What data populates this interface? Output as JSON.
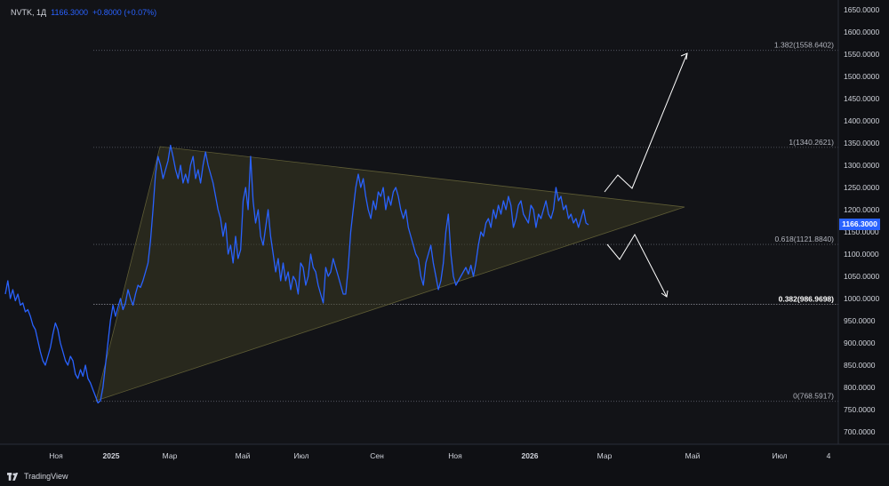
{
  "header": {
    "symbol": "NVTK, 1Д",
    "price": "1166.3000",
    "change": "+0.8000 (+0.07%)"
  },
  "price_tag": "1166.3000",
  "brand": "TradingView",
  "colors": {
    "background": "#0f1014",
    "line": "#2962ff",
    "triangle_fill": "#3a3820",
    "triangle_edge": "#6b6a3a",
    "fib_line": "#787b86",
    "arrow": "#ffffff",
    "axis_text": "#d1d4dc"
  },
  "chart_data": {
    "type": "line",
    "title": "",
    "xlabel": "",
    "ylabel": "",
    "ylim": [
      680,
      1665
    ],
    "y_ticks": [
      "1650.0000",
      "1600.0000",
      "1550.0000",
      "1500.0000",
      "1450.0000",
      "1400.0000",
      "1350.0000",
      "1300.0000",
      "1250.0000",
      "1200.0000",
      "1150.0000",
      "1100.0000",
      "1050.0000",
      "1000.0000",
      "950.0000",
      "900.0000",
      "850.0000",
      "800.0000",
      "750.0000",
      "700.0000"
    ],
    "x_ticks": [
      "Ноя",
      "2025",
      "Мар",
      "Май",
      "Июл",
      "Сен",
      "Ноя",
      "2026",
      "Мар",
      "Май",
      "Июл",
      "4"
    ],
    "x_tick_bold": [
      "2025",
      "2026"
    ],
    "grid": false,
    "series": [
      {
        "values": [
          1010,
          1040,
          1000,
          1020,
          995,
          1010,
          985,
          990,
          970,
          975,
          960,
          940,
          930,
          905,
          880,
          860,
          850,
          870,
          890,
          920,
          945,
          930,
          900,
          880,
          860,
          850,
          870,
          860,
          830,
          820,
          840,
          825,
          850,
          820,
          810,
          795,
          780,
          765,
          770,
          800,
          850,
          900,
          950,
          985,
          960,
          980,
          1000,
          975,
          990,
          1020,
          1000,
          985,
          1010,
          1030,
          1025,
          1040,
          1060,
          1080,
          1130,
          1200,
          1280,
          1320,
          1300,
          1270,
          1290,
          1310,
          1345,
          1320,
          1290,
          1270,
          1300,
          1260,
          1280,
          1260,
          1300,
          1320,
          1270,
          1290,
          1260,
          1300,
          1330,
          1300,
          1280,
          1260,
          1230,
          1200,
          1180,
          1140,
          1170,
          1100,
          1120,
          1080,
          1140,
          1090,
          1110,
          1220,
          1250,
          1200,
          1320,
          1220,
          1170,
          1200,
          1140,
          1120,
          1160,
          1200,
          1140,
          1100,
          1060,
          1090,
          1040,
          1080,
          1040,
          1060,
          1020,
          1050,
          1040,
          1010,
          1080,
          1070,
          1030,
          1050,
          1100,
          1070,
          1060,
          1030,
          1010,
          990,
          1070,
          1050,
          1060,
          1090,
          1070,
          1050,
          1030,
          1010,
          1010,
          1070,
          1150,
          1200,
          1250,
          1280,
          1250,
          1270,
          1230,
          1200,
          1180,
          1220,
          1200,
          1240,
          1230,
          1250,
          1200,
          1230,
          1210,
          1240,
          1250,
          1230,
          1200,
          1180,
          1200,
          1160,
          1140,
          1120,
          1100,
          1090,
          1050,
          1030,
          1080,
          1100,
          1120,
          1080,
          1050,
          1020,
          1040,
          1080,
          1150,
          1190,
          1100,
          1050,
          1030,
          1040,
          1050,
          1060,
          1070,
          1055,
          1075,
          1050,
          1080,
          1120,
          1150,
          1140,
          1170,
          1180,
          1160,
          1200,
          1180,
          1210,
          1190,
          1220,
          1200,
          1230,
          1210,
          1160,
          1180,
          1210,
          1220,
          1190,
          1180,
          1170,
          1210,
          1200,
          1160,
          1190,
          1180,
          1200,
          1220,
          1190,
          1180,
          1200,
          1250,
          1220,
          1230,
          1200,
          1210,
          1180,
          1190,
          1170,
          1180,
          1160,
          1180,
          1200,
          1170,
          1166
        ]
      }
    ],
    "fib_levels": [
      {
        "label": "1.382(1558.6402)",
        "value": 1558.6402,
        "bold": false
      },
      {
        "label": "1(1340.2621)",
        "value": 1340.2621,
        "bold": false
      },
      {
        "label": "0.618(1121.8840)",
        "value": 1121.884,
        "bold": false
      },
      {
        "label": "0.382(986.9698)",
        "value": 986.9698,
        "bold": true
      },
      {
        "label": "0(768.5917)",
        "value": 768.5917,
        "bold": false
      }
    ]
  }
}
